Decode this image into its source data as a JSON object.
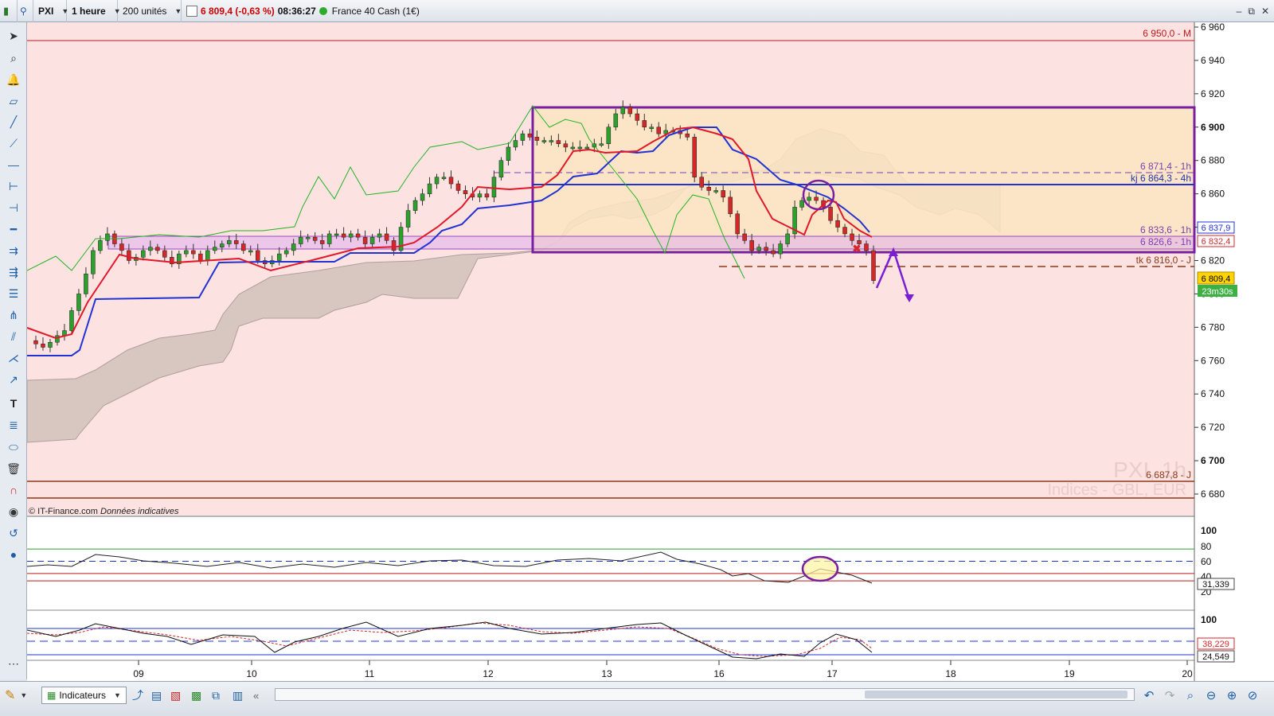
{
  "topbar": {
    "symbol": "PXI",
    "timeframe": "1 heure",
    "units": "200 unités",
    "price_change": "6 809,4 (-0,63 %)",
    "clock": "08:36:27",
    "instrument": "France 40 Cash (1€)"
  },
  "window_controls": [
    "–",
    "⧉",
    "✕"
  ],
  "chart": {
    "copyright": "© IT-Finance.com",
    "copyright_note": "Données indicatives",
    "watermark_symbol": "PXI, 1h",
    "watermark_sub": "Indices - GBL, EUR",
    "price_axis": [
      "6 960",
      "6 940",
      "6 920",
      "6 900",
      "6 880",
      "6 860",
      "6 840",
      "6 820",
      "6 800",
      "6 780",
      "6 760",
      "6 740",
      "6 720",
      "6 700",
      "6 680"
    ],
    "date_axis": [
      "09",
      "10",
      "11",
      "12",
      "13",
      "16",
      "17",
      "18",
      "19",
      "20"
    ],
    "level_labels": {
      "monthly": "6 950,0 - M",
      "h1_top": "6 871,4 - 1h",
      "kj4h": "kj 6 864,3 - 4h",
      "h1_mid": "6 833,6 - 1h",
      "h1_low": "6 826,6 - 1h",
      "tk": "tk 6 816,0 - J",
      "daily": "6 687,8 - J"
    },
    "tags": {
      "blue": "6 837,9",
      "red": "6 832,4",
      "price": "6 809,4",
      "timer": "23m30s"
    },
    "colors": {
      "background": "#fde2e2",
      "box_fill": "#fce5c2",
      "box_border": "#7a1fa2",
      "tenkan": "#e2182a",
      "kijun": "#2233d4",
      "chikou": "#22b322",
      "cloud": "#cbbcb6",
      "up": "#2ca02c",
      "down": "#d62728"
    }
  },
  "rsi": {
    "levels": [
      "100",
      "80",
      "60",
      "40",
      "20"
    ],
    "value": "31,339"
  },
  "stoch": {
    "level": "100",
    "value_k": "38,229",
    "value_d": "24,549"
  },
  "bottom": {
    "indicators_label": "Indicateurs"
  }
}
